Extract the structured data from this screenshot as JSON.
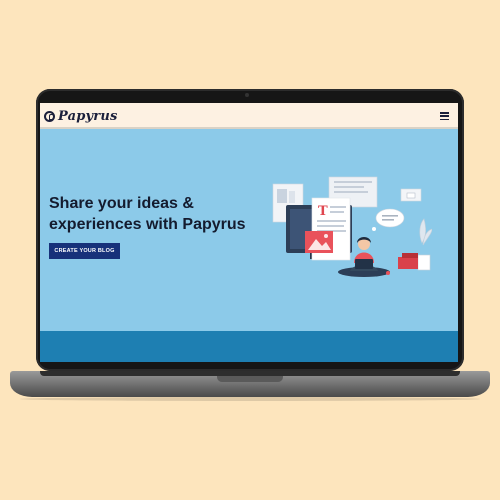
{
  "site": {
    "brand_name": "Papyrus",
    "logo_icon": "papyrus-p-logo",
    "menu_icon": "hamburger-menu"
  },
  "hero": {
    "title": "Share your ideas & experiences with Papyrus",
    "cta_label": "CREATE YOUR BLOG",
    "illustration": "person-laptop-blogging-illustration"
  },
  "colors": {
    "page_background": "#fde5bd",
    "navbar": "#fdf1e2",
    "hero_background": "#8ccae9",
    "cta": "#17317a",
    "band": "#1e7fb2",
    "text_dark": "#141b2e"
  }
}
